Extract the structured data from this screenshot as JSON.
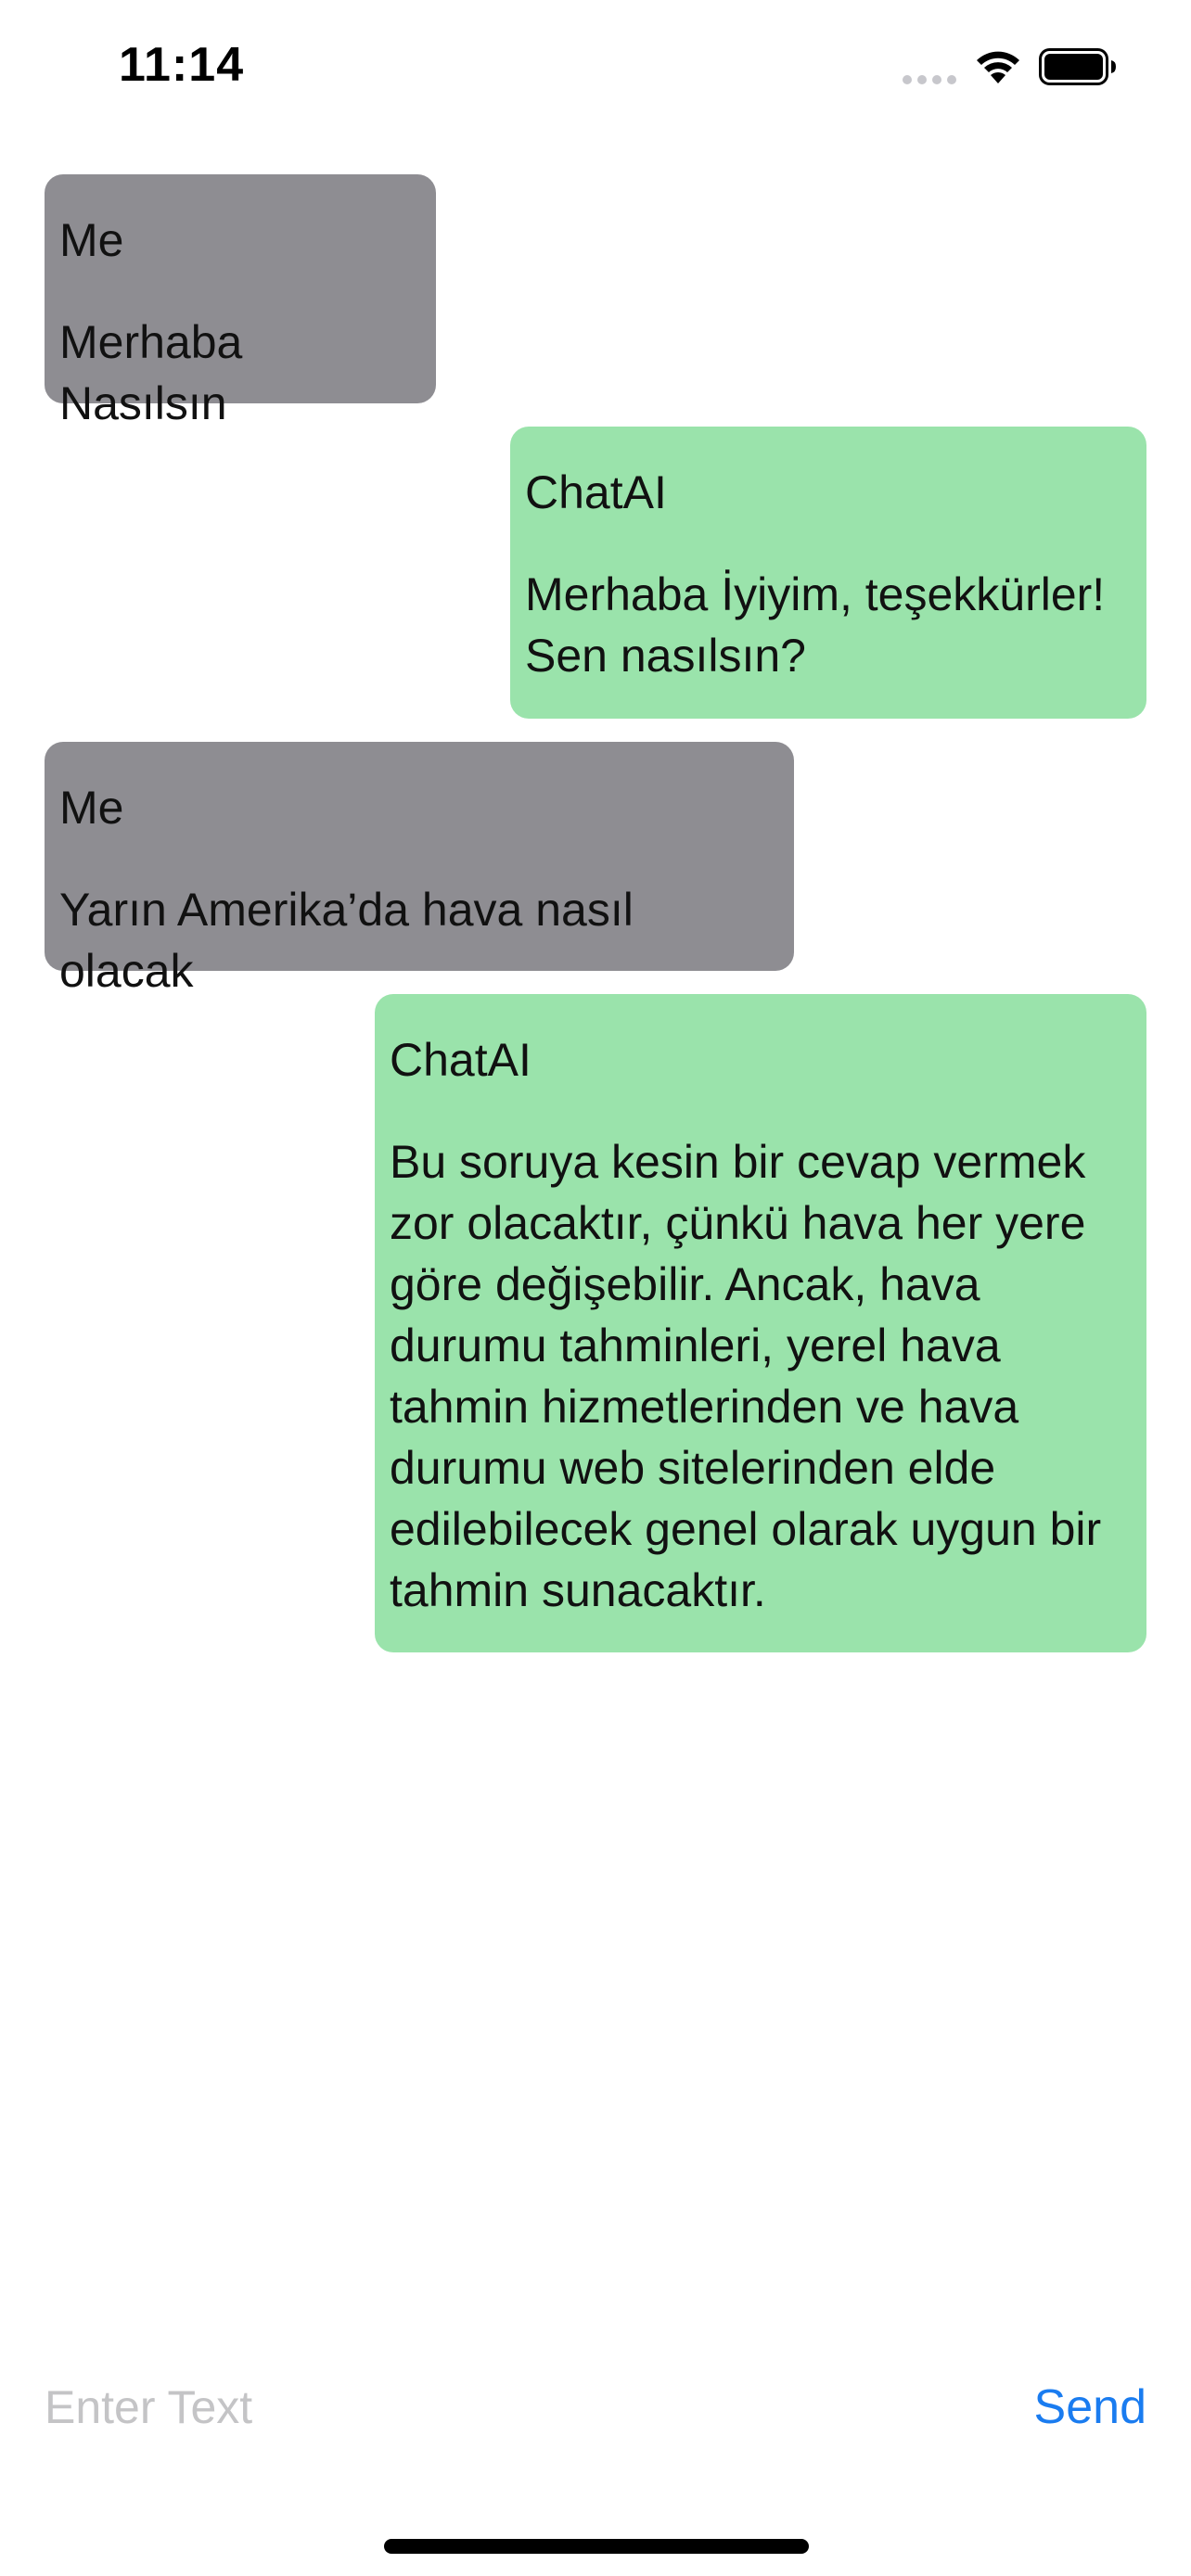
{
  "status_bar": {
    "time": "11:14",
    "icons": [
      "signal-icon",
      "wifi-icon",
      "battery-icon"
    ]
  },
  "messages": [
    {
      "sender": "Me",
      "text": "Merhaba Nasılsın",
      "role": "user"
    },
    {
      "sender": "ChatAI",
      "text": "Merhaba İyiyim, teşekkürler! Sen nasılsın?",
      "role": "assistant"
    },
    {
      "sender": "Me",
      "text": "Yarın Amerika’da hava nasıl olacak",
      "role": "user"
    },
    {
      "sender": "ChatAI",
      "text": "Bu soruya kesin bir cevap vermek zor olacaktır, çünkü hava her yere göre değişebilir. Ancak, hava durumu tahminleri, yerel hava tahmin hizmetlerinden ve hava durumu web sitelerinden elde edilebilecek genel olarak uygun bir tahmin sunacaktır.",
      "role": "assistant"
    }
  ],
  "input": {
    "placeholder": "Enter Text",
    "value": ""
  },
  "send_button": {
    "label": "Send"
  },
  "colors": {
    "user_bubble": "#8e8d92",
    "assistant_bubble": "#9ae3ab",
    "accent": "#1a7cf0",
    "placeholder": "#c4c4c6"
  }
}
